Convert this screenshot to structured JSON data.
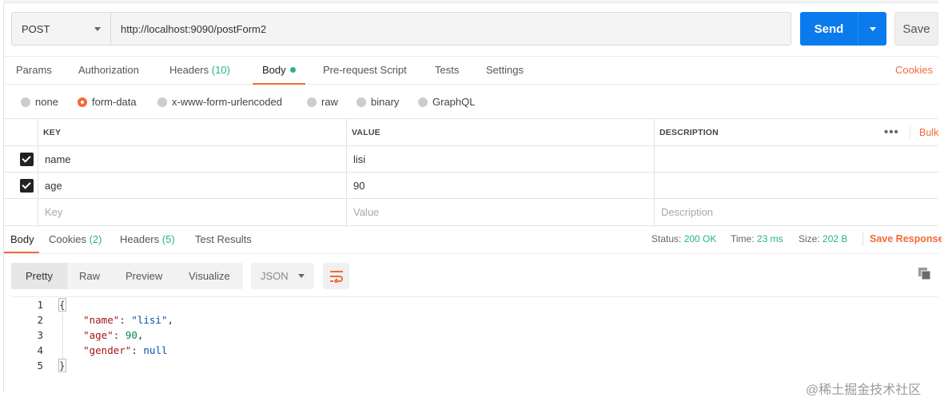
{
  "request": {
    "method": "POST",
    "url": "http://localhost:9090/postForm2",
    "send_label": "Send",
    "save_label": "Save"
  },
  "request_tabs": {
    "params": "Params",
    "authorization": "Authorization",
    "headers": "Headers",
    "headers_count": "(10)",
    "body": "Body",
    "pre_request": "Pre-request Script",
    "tests": "Tests",
    "settings": "Settings",
    "cookies": "Cookies"
  },
  "body_types": {
    "selected": "form-data",
    "options": [
      "none",
      "form-data",
      "x-www-form-urlencoded",
      "raw",
      "binary",
      "GraphQL"
    ]
  },
  "form_table": {
    "headers": {
      "key": "KEY",
      "value": "VALUE",
      "description": "DESCRIPTION"
    },
    "more": "•••",
    "bulk_edit": "Bulk",
    "rows": [
      {
        "key": "name",
        "value": "lisi",
        "checked": true
      },
      {
        "key": "age",
        "value": "90",
        "checked": true
      }
    ],
    "placeholders": {
      "key": "Key",
      "value": "Value",
      "description": "Description"
    }
  },
  "response_tabs": {
    "body": "Body",
    "cookies": "Cookies",
    "cookies_count": "(2)",
    "headers": "Headers",
    "headers_count": "(5)",
    "test_results": "Test Results"
  },
  "status": {
    "status_label": "Status:",
    "status_value": "200 OK",
    "time_label": "Time:",
    "time_value": "23 ms",
    "size_label": "Size:",
    "size_value": "202 B",
    "save_response": "Save Response"
  },
  "view": {
    "pretty": "Pretty",
    "raw": "Raw",
    "preview": "Preview",
    "visualize": "Visualize",
    "language": "JSON"
  },
  "code": {
    "line_numbers": [
      "1",
      "2",
      "3",
      "4",
      "5"
    ],
    "open_brace": "{",
    "close_brace": "}",
    "name_key": "\"name\"",
    "name_value": "\"lisi\"",
    "age_key": "\"age\"",
    "age_value": "90",
    "gender_key": "\"gender\"",
    "gender_value": "null"
  },
  "watermark": "@稀土掘金技术社区",
  "colors": {
    "accent": "#f26b3a",
    "send": "#097bed",
    "success": "#26b47f"
  }
}
